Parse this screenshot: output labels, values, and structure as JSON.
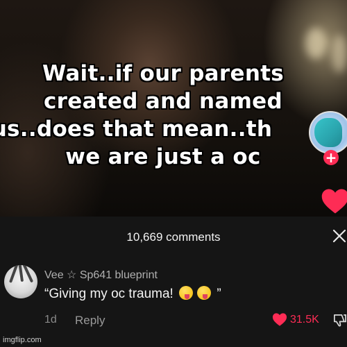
{
  "video": {
    "caption_lines": [
      "Wait..if our parents",
      "created and named",
      "us..does that mean..th",
      "we are just a oc"
    ]
  },
  "comments": {
    "count_label": "10,669 comments"
  },
  "comment": {
    "username": "Vee ☆ Sp641 blueprint",
    "text_before": "“Giving my oc trauma! ",
    "text_after": " ”",
    "emoji_icon": "zany-face-emoji",
    "time": "1d",
    "reply_label": "Reply",
    "likes": "31.5K"
  },
  "colors": {
    "accent": "#fe2c55",
    "panel": "#151515"
  },
  "watermark": "imgflip.com"
}
